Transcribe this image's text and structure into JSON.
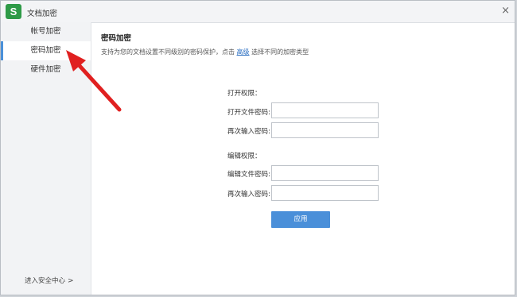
{
  "window": {
    "title": "文档加密",
    "close_glyph": "×"
  },
  "app": {
    "logo_letter": "S",
    "logo_color": "#2e9a47"
  },
  "sidebar": {
    "items": [
      {
        "label": "帐号加密",
        "active": false
      },
      {
        "label": "密码加密",
        "active": true
      },
      {
        "label": "硬件加密",
        "active": false
      }
    ],
    "footer_label": "进入安全中心",
    "footer_chevron": ">"
  },
  "main": {
    "heading": "密码加密",
    "desc_prefix": "支持为您的文档设置不同级别的密码保护，点击",
    "desc_link": "高级",
    "desc_suffix": "选择不同的加密类型",
    "open_permission": {
      "label": "打开权限：",
      "open_password_label": "打开文件密码:",
      "open_password_value": "",
      "confirm_label": "再次输入密码:",
      "confirm_value": ""
    },
    "edit_permission": {
      "label": "编辑权限：",
      "edit_password_label": "编辑文件密码:",
      "edit_password_value": "",
      "confirm_label": "再次输入密码:",
      "confirm_value": ""
    },
    "apply_label": "应用"
  },
  "colors": {
    "accent": "#4a8fd9",
    "link": "#2b6fc2",
    "annotation_arrow": "#e02020"
  }
}
